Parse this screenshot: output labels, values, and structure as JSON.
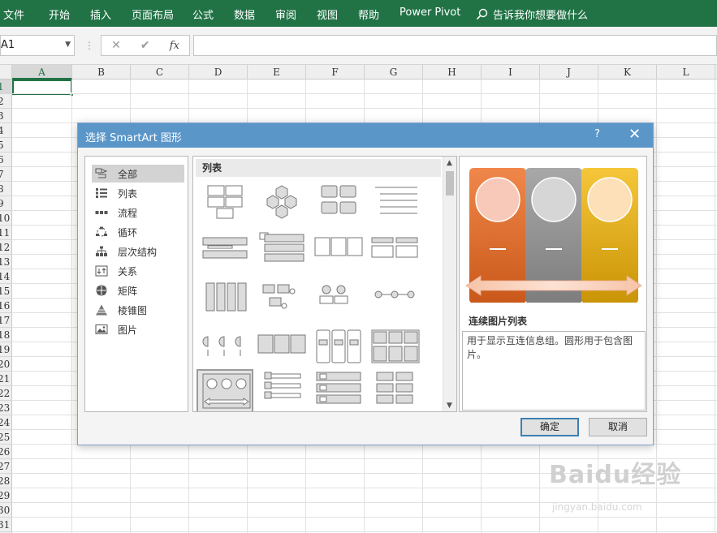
{
  "ribbon": {
    "tabs": [
      "文件",
      "开始",
      "插入",
      "页面布局",
      "公式",
      "数据",
      "审阅",
      "视图",
      "帮助",
      "Power Pivot"
    ],
    "tell_me": "告诉我你想要做什么",
    "color": "#217346"
  },
  "formula_bar": {
    "name_box": "A1",
    "cancel": "✕",
    "enter": "✔",
    "fx": "fx",
    "separator": "⋮"
  },
  "sheet": {
    "columns": [
      "A",
      "B",
      "C",
      "D",
      "E",
      "F",
      "G",
      "H",
      "I",
      "J",
      "K",
      "L"
    ],
    "rows": [
      "1",
      "2",
      "3",
      "4",
      "5",
      "6",
      "7",
      "8",
      "9",
      "10",
      "11",
      "12",
      "13",
      "14",
      "15",
      "16",
      "17",
      "18",
      "19",
      "20",
      "21",
      "22",
      "23",
      "24",
      "25",
      "26",
      "27",
      "28",
      "29",
      "30",
      "31"
    ],
    "active_cell": "A1"
  },
  "dialog": {
    "title": "选择 SmartArt 图形",
    "help": "?",
    "close": "✕",
    "categories": [
      {
        "label": "全部",
        "icon": "all-icon",
        "selected": true
      },
      {
        "label": "列表",
        "icon": "list-icon",
        "selected": false
      },
      {
        "label": "流程",
        "icon": "process-icon",
        "selected": false
      },
      {
        "label": "循环",
        "icon": "cycle-icon",
        "selected": false
      },
      {
        "label": "层次结构",
        "icon": "hierarchy-icon",
        "selected": false
      },
      {
        "label": "关系",
        "icon": "relationship-icon",
        "selected": false
      },
      {
        "label": "矩阵",
        "icon": "matrix-icon",
        "selected": false
      },
      {
        "label": "棱锥图",
        "icon": "pyramid-icon",
        "selected": false
      },
      {
        "label": "图片",
        "icon": "picture-icon",
        "selected": false
      }
    ],
    "gallery_header": "列表",
    "preview_name": "连续图片列表",
    "preview_desc": "用于显示互连信息组。圆形用于包含图片。",
    "preview_colors": [
      "#e8762c",
      "#9a9a9a",
      "#f2b31b"
    ],
    "ok": "确定",
    "cancel": "取消"
  },
  "watermark": {
    "brand": "Baidu经验",
    "url": "jingyan.baidu.com"
  }
}
